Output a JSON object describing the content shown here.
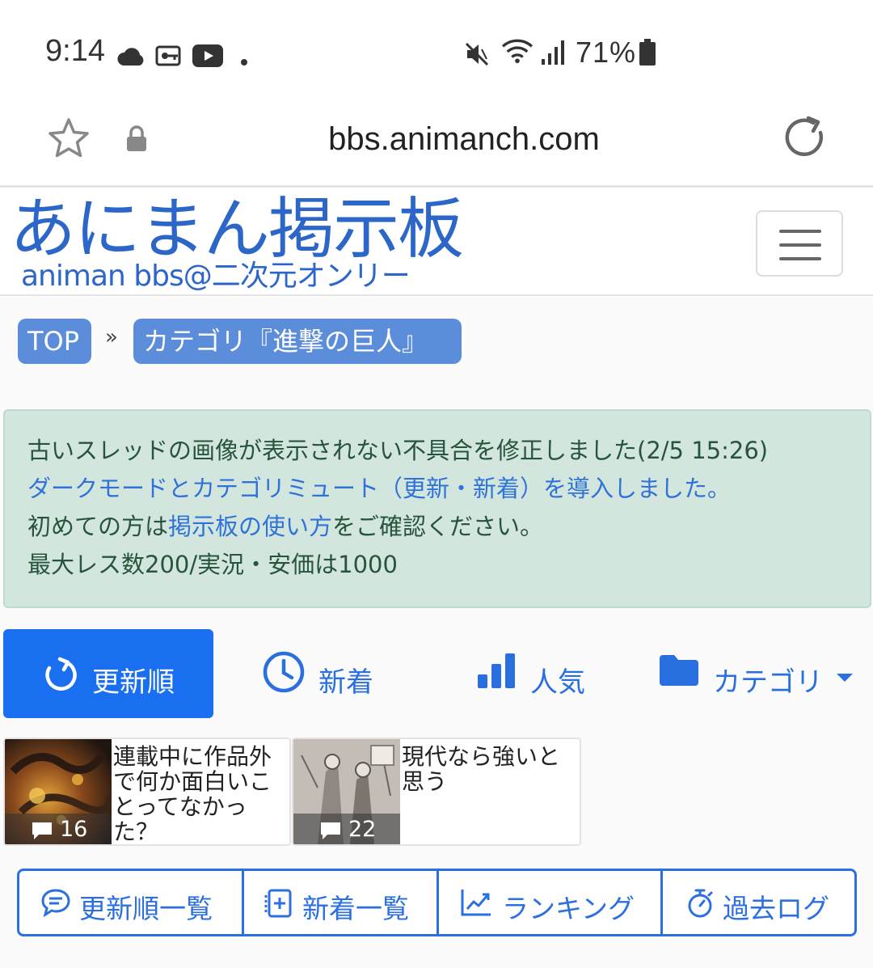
{
  "status_bar": {
    "time": "9:14",
    "battery_percent": "71%",
    "icons": [
      "cloud-icon",
      "vpn-key-icon",
      "youtube-icon",
      "dot-icon",
      "mute-icon",
      "wifi-icon",
      "signal-icon",
      "battery-icon"
    ]
  },
  "browser": {
    "url": "bbs.animanch.com",
    "icons": [
      "star-icon",
      "lock-icon",
      "reload-icon"
    ]
  },
  "site": {
    "logo_title": "あにまん掲示板",
    "logo_subtitle": "animan bbs@二次元オンリー",
    "menu_icon": "hamburger-menu-icon"
  },
  "breadcrumb": {
    "home": "TOP",
    "separator": "»",
    "current": "カテゴリ『進撃の巨人』"
  },
  "notice": {
    "line1": "古いスレッドの画像が表示されない不具合を修正しました(2/5 15:26)",
    "line2": "ダークモードとカテゴリミュート（更新・新着）を導入しました。",
    "line3_prefix": "初めての方は",
    "line3_link": "掲示板の使い方",
    "line3_suffix": "をご確認ください。",
    "line4": "最大レス数200/実況・安価は1000"
  },
  "sort_tabs": [
    {
      "label": "更新順",
      "icon": "refresh-icon",
      "active": true
    },
    {
      "label": "新着",
      "icon": "clock-icon",
      "active": false
    },
    {
      "label": "人気",
      "icon": "bar-chart-icon",
      "active": false
    },
    {
      "label": "カテゴリ",
      "icon": "folder-icon",
      "active": false
    }
  ],
  "threads": [
    {
      "title": "連載中に作品外で何か面白いことってなかった？",
      "comments": "16"
    },
    {
      "title": "現代なら強いと思う",
      "comments": "22"
    }
  ],
  "bottom_nav": [
    {
      "label": "更新順一覧",
      "icon": "chat-bubble-icon"
    },
    {
      "label": "新着一覧",
      "icon": "new-post-icon"
    },
    {
      "label": "ランキング",
      "icon": "trending-chart-icon"
    },
    {
      "label": "過去ログ",
      "icon": "stopwatch-icon"
    }
  ],
  "colors": {
    "brand_blue": "#2b66c8",
    "active_tab": "#1a6ff0",
    "notice_bg": "#d3e6de",
    "notice_text": "#27543d",
    "link": "#2f72d8",
    "breadcrumb_pill": "#5b8ddb"
  }
}
